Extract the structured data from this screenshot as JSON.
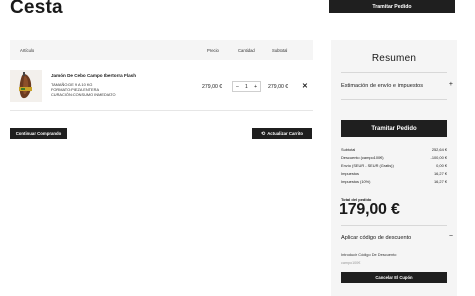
{
  "page": {
    "title": "Cesta"
  },
  "header": {
    "checkout_label": "Tramitar Pedido"
  },
  "cart": {
    "columns": {
      "item": "Artículo",
      "price": "Precio",
      "qty": "Cantidad",
      "subtotal": "Subtotal"
    },
    "items": [
      {
        "name": "Jamón De Cebo Campo Ibertorra Flash",
        "meta": [
          "TAMAÑO:DE 9 A 10 KG",
          "FORMATO:PIEZA ENTERA",
          "CURACIÓN:CONSUMO INMEDIATO"
        ],
        "price": "279,00 €",
        "quantity": "1",
        "subtotal": "279,00 €"
      }
    ],
    "continue_label": "Continuar Comprando",
    "update_label": "Actualizar Carrito"
  },
  "summary": {
    "title": "Resumen",
    "shipping_estimate_label": "Estimación de envío e impuestos",
    "checkout_label": "Tramitar Pedido",
    "rows": [
      {
        "label": "Subtotal",
        "value": "252,64 €"
      },
      {
        "label": "Descuento (campo100€)",
        "value": "-100,00 €"
      },
      {
        "label": "Envío (SEUR - SEUR (Gratis))",
        "value": "0,00 €"
      },
      {
        "label": "Impuestos",
        "value": "16,27 €"
      },
      {
        "label": "Impuestos (10%)",
        "value": "16,27 €"
      }
    ],
    "total_label": "Total del pedido",
    "total_value": "179,00 €",
    "coupon": {
      "title": "Aplicar código de descuento",
      "field_label": "Introducir Código De Descuento",
      "value": "campo100€",
      "cancel_label": "Cancelar El Cupón"
    }
  }
}
